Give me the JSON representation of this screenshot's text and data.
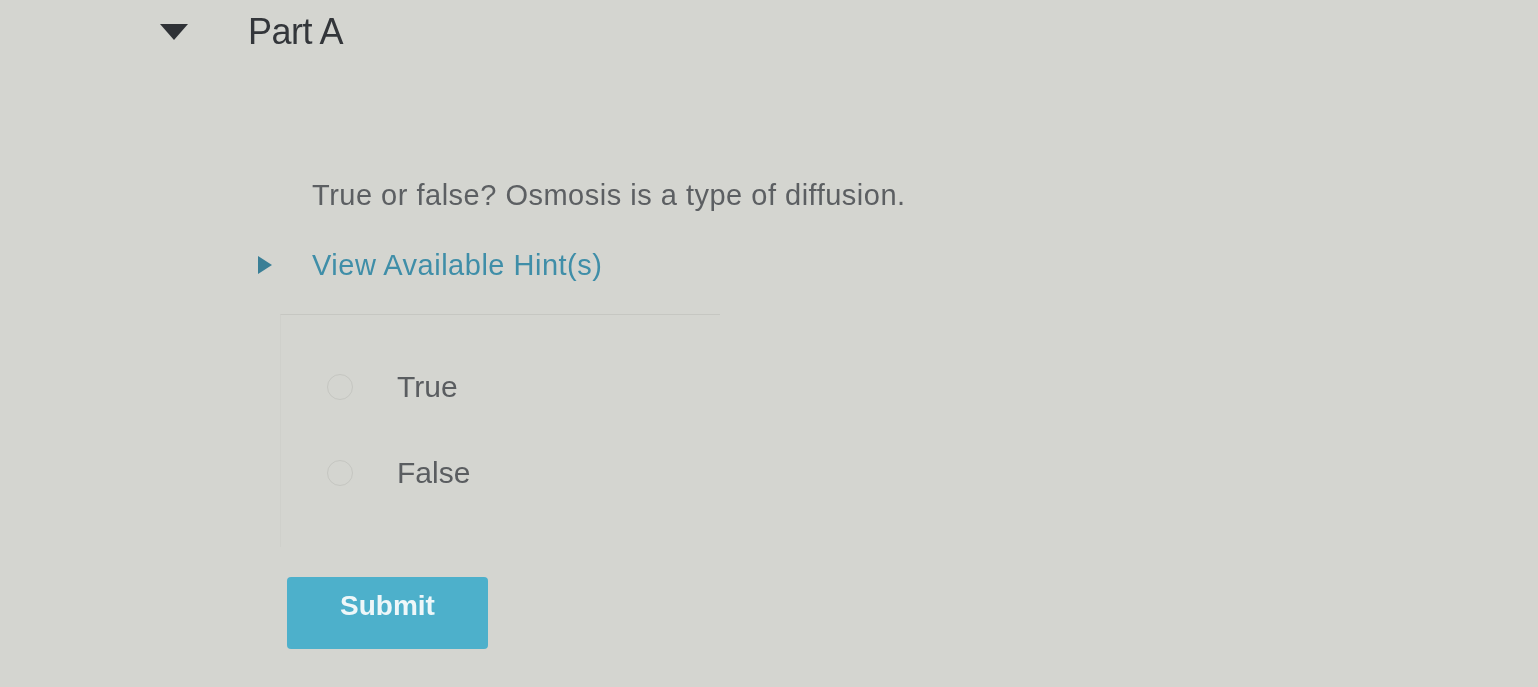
{
  "part": {
    "title": "Part A",
    "expanded": true
  },
  "question": {
    "prompt": "True or false? Osmosis is a type of diffusion."
  },
  "hints": {
    "label": "View Available Hint(s)",
    "expanded": false
  },
  "options": [
    {
      "label": "True",
      "selected": false
    },
    {
      "label": "False",
      "selected": false
    }
  ],
  "submit": {
    "label": "Submit"
  }
}
